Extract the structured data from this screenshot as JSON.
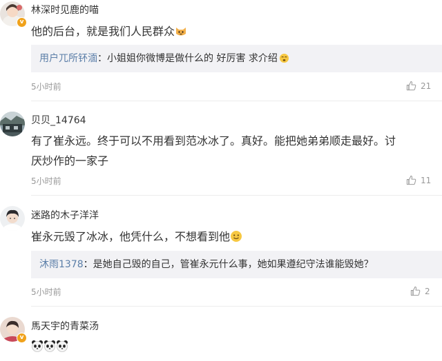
{
  "comments": [
    {
      "username": "林深时见鹿的喵",
      "text": "他的后台，就是我们人民群众",
      "verified": true,
      "reply_user": "用户兀所钚湎",
      "reply_text": "：小姐姐你微博是做什么的 好厉害 求介绍",
      "time": "5小时前",
      "likes": "21"
    },
    {
      "username": "贝贝_14764",
      "text_line1": "有了崔永远。终于可以不用看到范冰冰了。真好。能把她弟弟顺走最好。讨",
      "text_line2": "厌炒作的一家子",
      "time": "5小时前",
      "likes": "11"
    },
    {
      "username": "迷路的木子洋洋",
      "text": "崔永元毁了冰冰，他凭什么，不想看到他",
      "reply_user": "沐雨1378",
      "reply_text": "：是她自己毁的自己，管崔永元什么事，她如果遵纪守法谁能毁她？",
      "time": "5小时前",
      "likes": "2"
    },
    {
      "username": "馬天宇的青菜汤",
      "verified": true
    }
  ],
  "icons": {
    "like": "thumbs-up-icon",
    "verified": "verified-badge-icon"
  },
  "colors": {
    "link": "#5b7ea8",
    "reply_bg": "#f2f2f5",
    "meta": "#999999",
    "badge": "#f0a21b"
  }
}
